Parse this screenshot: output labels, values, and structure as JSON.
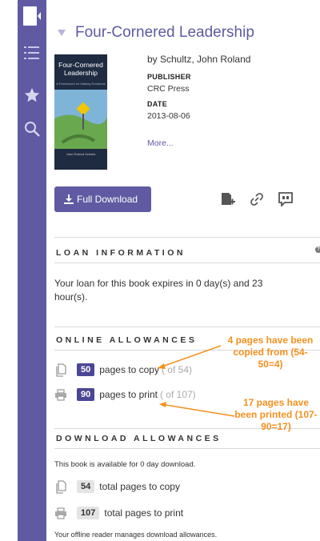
{
  "top_strip_text": "",
  "book": {
    "title": "Four-Cornered Leadership",
    "byline": "by Schultz, John Roland",
    "publisher_label": "PUBLISHER",
    "publisher": "CRC Press",
    "date_label": "DATE",
    "date": "2013-08-06",
    "more": "More...",
    "cover_title": "Four-Cornered Leadership",
    "cover_subtitle": "A Framework for Making Decisions",
    "cover_author": "John Roland Schultz"
  },
  "actions": {
    "full_download": "Full Download"
  },
  "loan": {
    "heading": "LOAN INFORMATION",
    "text": "Your loan for this book expires in 0 day(s) and 23 hour(s)."
  },
  "online": {
    "heading": "ONLINE ALLOWANCES",
    "copy_count": "50",
    "copy_label": "pages to copy",
    "copy_total": "( of 54)",
    "print_count": "90",
    "print_label": "pages to print",
    "print_total": "( of 107)"
  },
  "download": {
    "heading": "DOWNLOAD ALLOWANCES",
    "availability": "This book is available for 0 day download.",
    "copy_count": "54",
    "copy_label": "total pages to copy",
    "print_count": "107",
    "print_label": "total pages to print",
    "footer": "Your offline reader manages download allowances."
  },
  "annotations": {
    "copied": "4 pages have been copied from (54-50=4)",
    "printed": "17 pages have been printed (107-90=17)"
  },
  "colors": {
    "accent": "#5f5aa2",
    "annotation": "#f5901e"
  }
}
